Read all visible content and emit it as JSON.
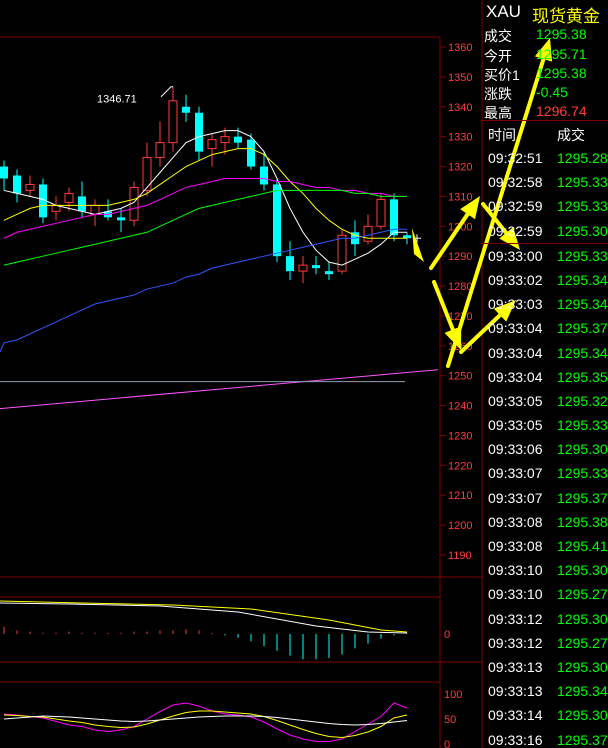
{
  "quote": {
    "symbol": "XAU",
    "name": "现货黄金",
    "stats": [
      {
        "label": "成交",
        "value": "1295.38",
        "color": "#00ff00"
      },
      {
        "label": "今开",
        "value": "1295.71",
        "color": "#00ff00"
      },
      {
        "label": "买价1",
        "value": "1295.38",
        "color": "#00ff00"
      },
      {
        "label": "涨跌",
        "value": "-0.45",
        "color": "#00ff00"
      },
      {
        "label": "最高",
        "value": "1296.74",
        "color": "#ff3b3b"
      }
    ],
    "columns": {
      "time": "时间",
      "price": "成交"
    },
    "ticks": [
      {
        "time": "09:32:51",
        "price": "1295.28"
      },
      {
        "time": "09:32:58",
        "price": "1295.33"
      },
      {
        "time": "09:32:59",
        "price": "1295.33"
      },
      {
        "time": "09:32:59",
        "price": "1295.30"
      },
      {
        "time": "09:33:00",
        "price": "1295.33"
      },
      {
        "time": "09:33:02",
        "price": "1295.34"
      },
      {
        "time": "09:33:03",
        "price": "1295.34"
      },
      {
        "time": "09:33:04",
        "price": "1295.37"
      },
      {
        "time": "09:33:04",
        "price": "1295.34"
      },
      {
        "time": "09:33:04",
        "price": "1295.35"
      },
      {
        "time": "09:33:05",
        "price": "1295.32"
      },
      {
        "time": "09:33:05",
        "price": "1295.33"
      },
      {
        "time": "09:33:06",
        "price": "1295.30"
      },
      {
        "time": "09:33:07",
        "price": "1295.33"
      },
      {
        "time": "09:33:07",
        "price": "1295.37"
      },
      {
        "time": "09:33:08",
        "price": "1295.38"
      },
      {
        "time": "09:33:08",
        "price": "1295.41"
      },
      {
        "time": "09:33:10",
        "price": "1295.30"
      },
      {
        "time": "09:33:10",
        "price": "1295.27"
      },
      {
        "time": "09:33:12",
        "price": "1295.30"
      },
      {
        "time": "09:33:12",
        "price": "1295.27"
      },
      {
        "time": "09:33:13",
        "price": "1295.30"
      },
      {
        "time": "09:33:13",
        "price": "1295.34"
      },
      {
        "time": "09:33:14",
        "price": "1295.30"
      },
      {
        "time": "09:33:16",
        "price": "1295.37"
      }
    ]
  },
  "chart_data": {
    "type": "candlestick",
    "price_axis": {
      "ylim": [
        1185,
        1365
      ],
      "ticks": [
        "1360",
        "1350",
        "1340",
        "1330",
        "1320",
        "1310",
        "1300",
        "1290",
        "1280",
        "1270",
        "1260",
        "1250",
        "1240",
        "1230",
        "1220",
        "1210",
        "1200",
        "1190"
      ]
    },
    "high_annotation": "1346.71",
    "candles": [
      {
        "o": 1320,
        "h": 1322,
        "l": 1312,
        "c": 1316
      },
      {
        "o": 1317,
        "h": 1319,
        "l": 1308,
        "c": 1311
      },
      {
        "o": 1312,
        "h": 1317,
        "l": 1310,
        "c": 1314
      },
      {
        "o": 1314,
        "h": 1316,
        "l": 1301,
        "c": 1303
      },
      {
        "o": 1305,
        "h": 1310,
        "l": 1302,
        "c": 1307
      },
      {
        "o": 1308,
        "h": 1313,
        "l": 1305,
        "c": 1311
      },
      {
        "o": 1310,
        "h": 1315,
        "l": 1303,
        "c": 1305
      },
      {
        "o": 1304,
        "h": 1309,
        "l": 1300,
        "c": 1307
      },
      {
        "o": 1305,
        "h": 1309,
        "l": 1302,
        "c": 1303
      },
      {
        "o": 1303,
        "h": 1306,
        "l": 1298,
        "c": 1302
      },
      {
        "o": 1302,
        "h": 1315,
        "l": 1300,
        "c": 1313
      },
      {
        "o": 1312,
        "h": 1328,
        "l": 1310,
        "c": 1323
      },
      {
        "o": 1323,
        "h": 1335,
        "l": 1320,
        "c": 1328
      },
      {
        "o": 1328,
        "h": 1346.71,
        "l": 1325,
        "c": 1342
      },
      {
        "o": 1340,
        "h": 1344,
        "l": 1335,
        "c": 1338
      },
      {
        "o": 1338,
        "h": 1340,
        "l": 1322,
        "c": 1325
      },
      {
        "o": 1326,
        "h": 1331,
        "l": 1320,
        "c": 1329
      },
      {
        "o": 1328,
        "h": 1333,
        "l": 1324,
        "c": 1330
      },
      {
        "o": 1330,
        "h": 1333,
        "l": 1326,
        "c": 1328
      },
      {
        "o": 1329,
        "h": 1331,
        "l": 1319,
        "c": 1320
      },
      {
        "o": 1320,
        "h": 1325,
        "l": 1312,
        "c": 1314
      },
      {
        "o": 1314,
        "h": 1316,
        "l": 1288,
        "c": 1290
      },
      {
        "o": 1290,
        "h": 1295,
        "l": 1282,
        "c": 1285
      },
      {
        "o": 1285,
        "h": 1290,
        "l": 1281,
        "c": 1287
      },
      {
        "o": 1287,
        "h": 1290,
        "l": 1284,
        "c": 1286
      },
      {
        "o": 1285,
        "h": 1288,
        "l": 1282,
        "c": 1284
      },
      {
        "o": 1285,
        "h": 1299,
        "l": 1284,
        "c": 1297
      },
      {
        "o": 1298,
        "h": 1302,
        "l": 1290,
        "c": 1294
      },
      {
        "o": 1295,
        "h": 1304,
        "l": 1294,
        "c": 1300
      },
      {
        "o": 1300,
        "h": 1311,
        "l": 1299,
        "c": 1309
      },
      {
        "o": 1309,
        "h": 1311,
        "l": 1295,
        "c": 1297
      },
      {
        "o": 1297,
        "h": 1298,
        "l": 1294,
        "c": 1296
      }
    ],
    "ma_lines": [
      {
        "color": "#ffffff",
        "values": [
          1312,
          1311,
          1310,
          1309,
          1307,
          1306,
          1305,
          1304,
          1305,
          1306,
          1308,
          1313,
          1318,
          1323,
          1328,
          1330,
          1331,
          1332,
          1332,
          1330,
          1325,
          1316,
          1306,
          1298,
          1292,
          1288,
          1287,
          1289,
          1291,
          1294,
          1298,
          1298
        ]
      },
      {
        "color": "#ffff00",
        "values": [
          1302,
          1304,
          1306,
          1307,
          1307,
          1307,
          1307,
          1307,
          1307,
          1308,
          1309,
          1311,
          1314,
          1317,
          1320,
          1322,
          1324,
          1325,
          1326,
          1326,
          1324,
          1320,
          1315,
          1311,
          1306,
          1302,
          1299,
          1297,
          1296,
          1296,
          1296,
          1296
        ]
      },
      {
        "color": "#ff00ff",
        "values": [
          1296,
          1298,
          1299,
          1300,
          1301,
          1302,
          1303,
          1304,
          1304,
          1305,
          1306,
          1307,
          1309,
          1311,
          1313,
          1314,
          1315,
          1316,
          1316,
          1316,
          1316,
          1315,
          1315,
          1314,
          1313,
          1313,
          1312,
          1312,
          1311,
          1311,
          1310,
          1310
        ]
      },
      {
        "color": "#00ff00",
        "values": [
          1287,
          1288,
          1289,
          1290,
          1291,
          1292,
          1293,
          1294,
          1295,
          1296,
          1297,
          1298,
          1300,
          1302,
          1304,
          1306,
          1307,
          1308,
          1309,
          1310,
          1311,
          1312,
          1312,
          1312,
          1312,
          1312,
          1312,
          1311,
          1311,
          1310,
          1310,
          1310
        ]
      },
      {
        "color": "#3355ff",
        "values": [
          1261,
          1262,
          1264,
          1266,
          1268,
          1270,
          1272,
          1274,
          1275,
          1276,
          1277,
          1279,
          1280,
          1281,
          1283,
          1284,
          1286,
          1287,
          1288,
          1289,
          1290,
          1291,
          1292,
          1293,
          1294,
          1295,
          1296,
          1296,
          1297,
          1298,
          1299,
          1299
        ]
      }
    ],
    "long_lines": [
      {
        "color": "#ff55ff",
        "from": 1239,
        "to": 1252
      },
      {
        "color": "#8fa0b0",
        "from": 1248,
        "to": 1248
      }
    ],
    "macd": {
      "zero_label": "0",
      "bars": [
        0.6,
        0.3,
        0.2,
        0.1,
        0.1,
        0.2,
        0.1,
        0.1,
        0.1,
        0.1,
        0.2,
        0.2,
        0.3,
        0.3,
        0.4,
        0.3,
        0.1,
        -0.1,
        -0.3,
        -0.6,
        -1.0,
        -1.4,
        -1.8,
        -2.1,
        -2.1,
        -2.0,
        -1.7,
        -1.2,
        -0.8,
        -0.4,
        -0.1,
        0.1
      ]
    },
    "kdj": {
      "ticks": [
        "100",
        "50",
        "0"
      ],
      "k": [
        60,
        58,
        55,
        52,
        45,
        38,
        35,
        28,
        25,
        28,
        35,
        50,
        65,
        78,
        82,
        76,
        66,
        60,
        58,
        54,
        44,
        30,
        18,
        10,
        5,
        5,
        10,
        25,
        40,
        55,
        82,
        72
      ],
      "d": [
        58,
        57,
        55,
        54,
        50,
        46,
        43,
        38,
        35,
        33,
        34,
        40,
        48,
        56,
        63,
        66,
        66,
        64,
        62,
        60,
        55,
        47,
        38,
        29,
        21,
        15,
        13,
        17,
        24,
        35,
        52,
        58
      ],
      "j": [
        50,
        52,
        54,
        56,
        55,
        54,
        52,
        50,
        48,
        46,
        45,
        46,
        48,
        50,
        52,
        54,
        55,
        56,
        56,
        56,
        55,
        53,
        50,
        47,
        44,
        41,
        39,
        38,
        39,
        41,
        44,
        47
      ]
    }
  }
}
